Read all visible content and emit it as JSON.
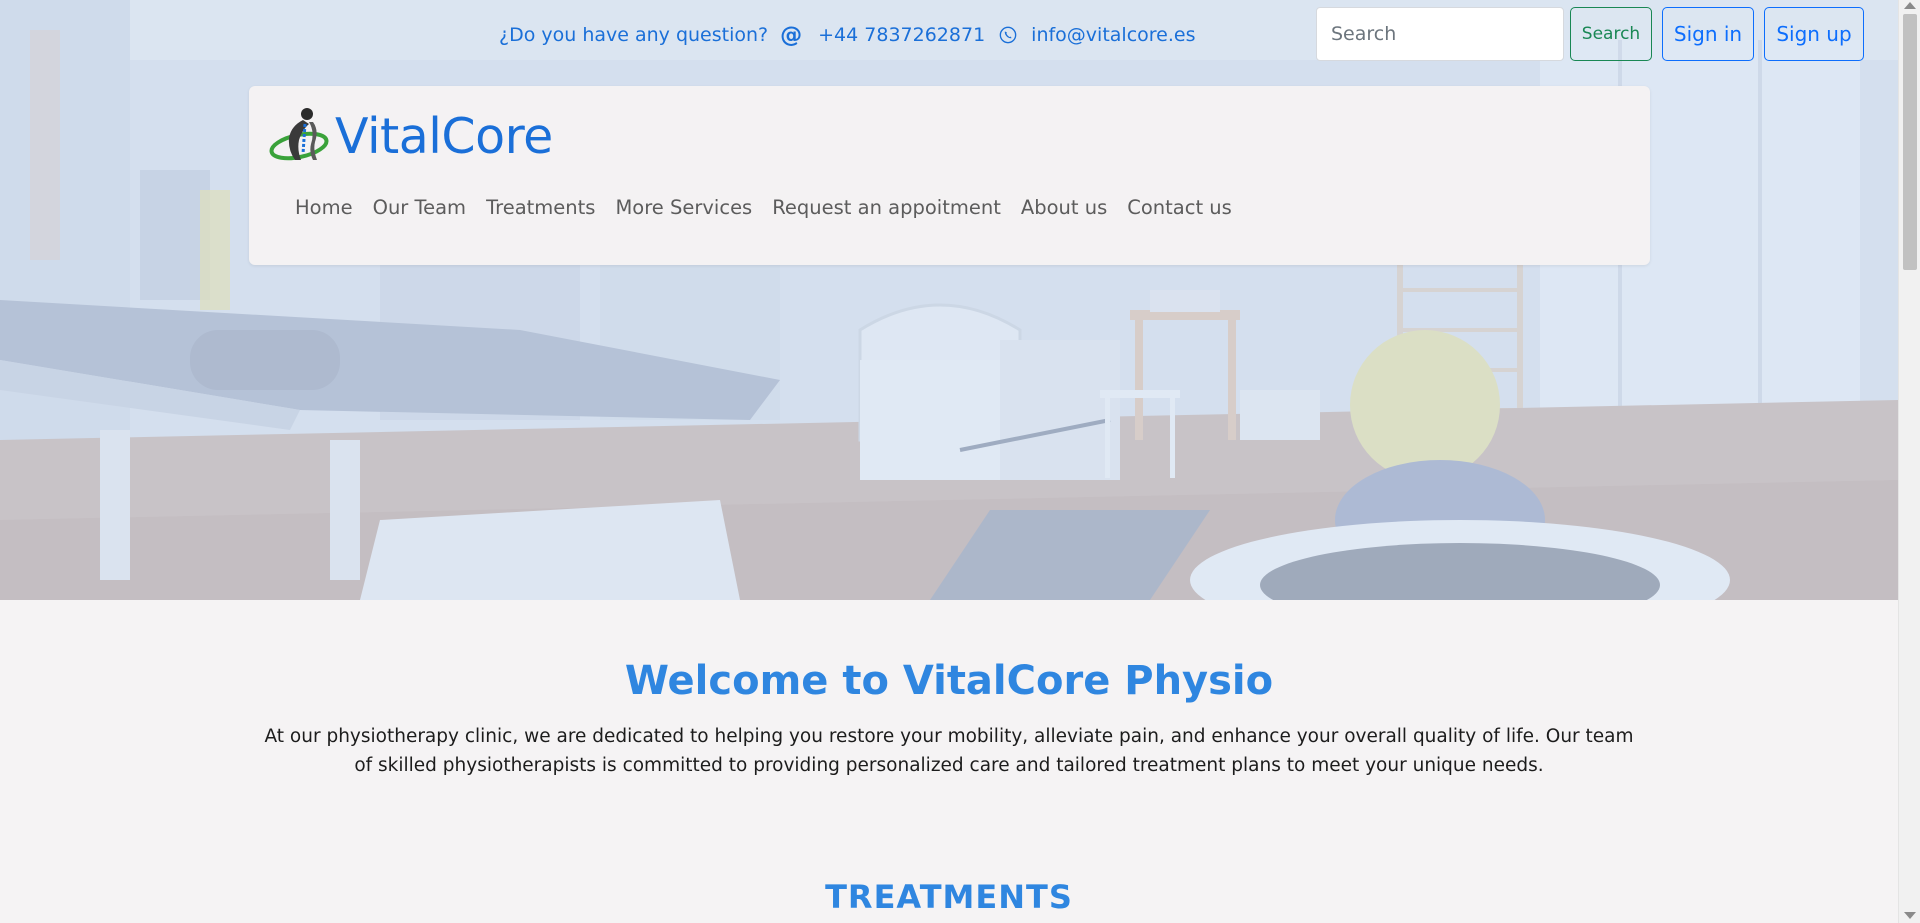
{
  "contact": {
    "question": "¿Do you have any question?",
    "at_symbol": "@",
    "phone": "+44 7837262871",
    "email": "info@vitalcore.es"
  },
  "header": {
    "search_placeholder": "Search",
    "search_button": "Search",
    "signin_button": "Sign in",
    "signup_button": "Sign up"
  },
  "brand": {
    "name": "VitalCore",
    "logo_icon": "spine-figure-logo"
  },
  "nav": {
    "items": [
      {
        "label": "Home"
      },
      {
        "label": "Our Team"
      },
      {
        "label": "Treatments"
      },
      {
        "label": "More Services"
      },
      {
        "label": "Request an appoitment"
      },
      {
        "label": "About us"
      },
      {
        "label": "Contact us"
      }
    ]
  },
  "main": {
    "welcome_title": "Welcome to VitalCore Physio",
    "intro_text": "At our physiotherapy clinic, we are dedicated to helping you restore your mobility, alleviate pain, and enhance your overall quality of life. Our team of skilled physiotherapists is committed to providing personalized care and tailored treatment plans to meet your unique needs.",
    "section_title": "TREATMENTS"
  },
  "colors": {
    "accent": "#1a6fd8",
    "heading_blue": "#2f86e0",
    "search_green": "#198754",
    "outline_blue": "#0d6efd",
    "background": "#f5f3f4"
  }
}
